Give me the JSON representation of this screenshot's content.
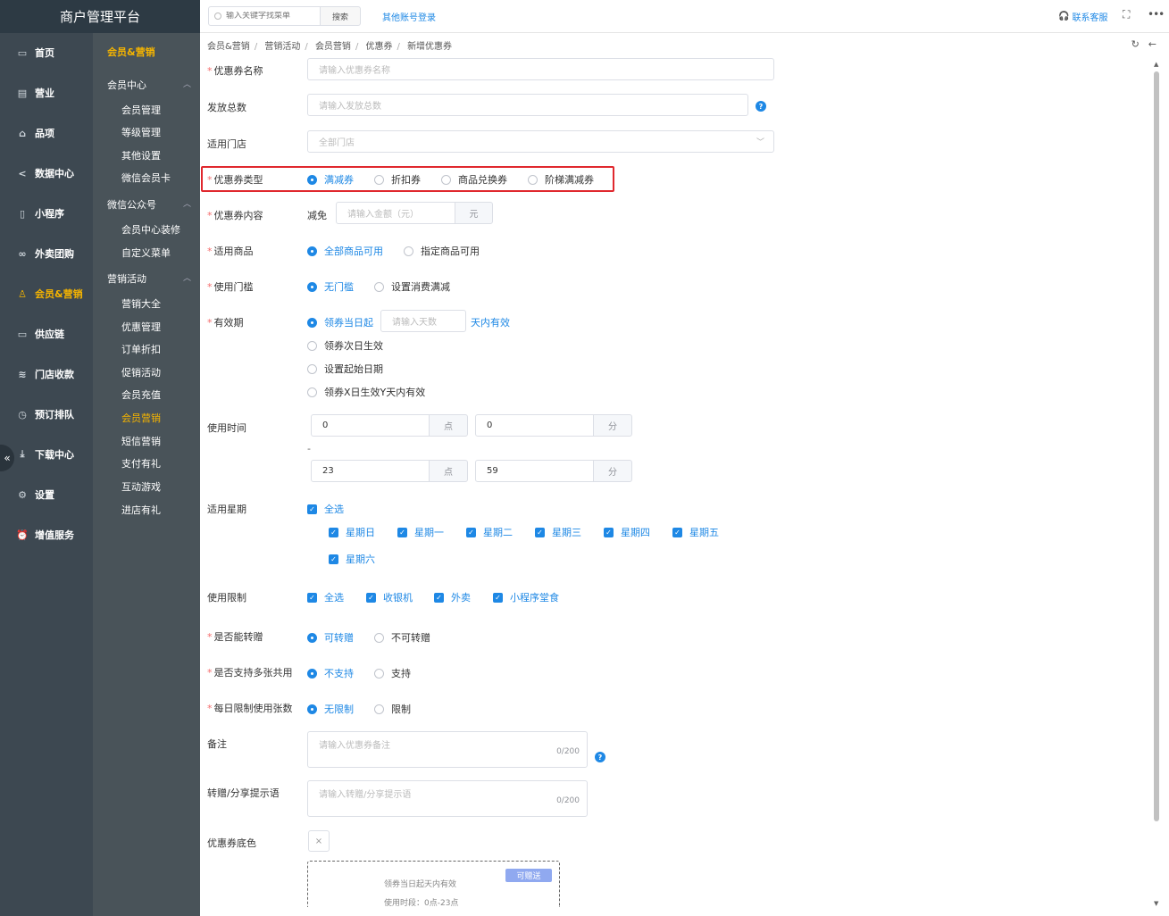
{
  "brand": {
    "title": "商户管理平台"
  },
  "topbar": {
    "search_placeholder": "输入关键字找菜单",
    "search_button": "搜索",
    "other_login": "其他账号登录",
    "contact": "联系客服"
  },
  "sidebar_primary": [
    {
      "label": "首页",
      "icon": "home-icon"
    },
    {
      "label": "营业",
      "icon": "business-icon"
    },
    {
      "label": "品项",
      "icon": "bag-icon"
    },
    {
      "label": "数据中心",
      "icon": "share-icon"
    },
    {
      "label": "小程序",
      "icon": "phone-icon"
    },
    {
      "label": "外卖团购",
      "icon": "bike-icon"
    },
    {
      "label": "会员&营销",
      "icon": "user-icon",
      "active": true
    },
    {
      "label": "供应链",
      "icon": "truck-icon"
    },
    {
      "label": "门店收款",
      "icon": "coins-icon"
    },
    {
      "label": "预订排队",
      "icon": "clock-icon"
    },
    {
      "label": "下载中心",
      "icon": "download-icon"
    },
    {
      "label": "设置",
      "icon": "gear-icon"
    },
    {
      "label": "增值服务",
      "icon": "alarm-icon"
    }
  ],
  "sidebar_secondary": {
    "head": "会员&营销",
    "groups": [
      {
        "label": "会员中心",
        "items": [
          "会员管理",
          "等级管理",
          "其他设置",
          "微信会员卡"
        ]
      },
      {
        "label": "微信公众号",
        "items": [
          "会员中心装修",
          "自定义菜单"
        ]
      },
      {
        "label": "营销活动",
        "items": [
          "营销大全",
          "优惠管理",
          "订单折扣",
          "促销活动",
          "会员充值",
          "会员营销",
          "短信营销",
          "支付有礼",
          "互动游戏",
          "进店有礼"
        ]
      }
    ],
    "active_item": "会员营销"
  },
  "breadcrumb": [
    "会员&营销",
    "营销活动",
    "会员营销",
    "优惠券",
    "新增优惠券"
  ],
  "form": {
    "name": {
      "label": "优惠券名称",
      "placeholder": "请输入优惠券名称"
    },
    "total": {
      "label": "发放总数",
      "placeholder": "请输入发放总数"
    },
    "store": {
      "label": "适用门店",
      "placeholder": "全部门店"
    },
    "type": {
      "label": "优惠券类型",
      "options": [
        "满减券",
        "折扣券",
        "商品兑换券",
        "阶梯满减券"
      ],
      "selected": 0
    },
    "content": {
      "label": "优惠券内容",
      "prefix": "减免",
      "placeholder": "请输入金额（元）",
      "unit": "元"
    },
    "goods": {
      "label": "适用商品",
      "options": [
        "全部商品可用",
        "指定商品可用"
      ],
      "selected": 0
    },
    "threshold": {
      "label": "使用门槛",
      "options": [
        "无门槛",
        "设置消费满减"
      ],
      "selected": 0
    },
    "validity": {
      "label": "有效期",
      "opt1": "领券当日起",
      "days_placeholder": "请输入天数",
      "suffix": "天内有效",
      "opt2": "领券次日生效",
      "opt3": "设置起始日期",
      "opt4": "领券X日生效Y天内有效"
    },
    "use_time": {
      "label": "使用时间",
      "start_hour": "0",
      "start_min": "0",
      "end_hour": "23",
      "end_min": "59",
      "hour_unit": "点",
      "min_unit": "分",
      "dash": "-"
    },
    "weekdays": {
      "label": "适用星期",
      "all": "全选",
      "days": [
        "星期日",
        "星期一",
        "星期二",
        "星期三",
        "星期四",
        "星期五",
        "星期六"
      ]
    },
    "limit": {
      "label": "使用限制",
      "options": [
        "全选",
        "收银机",
        "外卖",
        "小程序堂食"
      ]
    },
    "transfer": {
      "label": "是否能转赠",
      "options": [
        "可转赠",
        "不可转赠"
      ],
      "selected": 0
    },
    "multi": {
      "label": "是否支持多张共用",
      "options": [
        "不支持",
        "支持"
      ],
      "selected": 0
    },
    "daily_limit": {
      "label": "每日限制使用张数",
      "options": [
        "无限制",
        "限制"
      ],
      "selected": 0
    },
    "remark": {
      "label": "备注",
      "placeholder": "请输入优惠券备注",
      "count": "0/200"
    },
    "share_tip": {
      "label": "转赠/分享提示语",
      "placeholder": "请输入转赠/分享提示语",
      "count": "0/200"
    },
    "bg_color": {
      "label": "优惠券底色"
    }
  },
  "preview": {
    "badge": "可赠送",
    "line1": "领券当日起天内有效",
    "line2": "使用时段：0点-23点"
  },
  "colors": {
    "accent": "#1e88e5",
    "active_menu": "#f5b400",
    "highlight_box": "#e0282e"
  }
}
